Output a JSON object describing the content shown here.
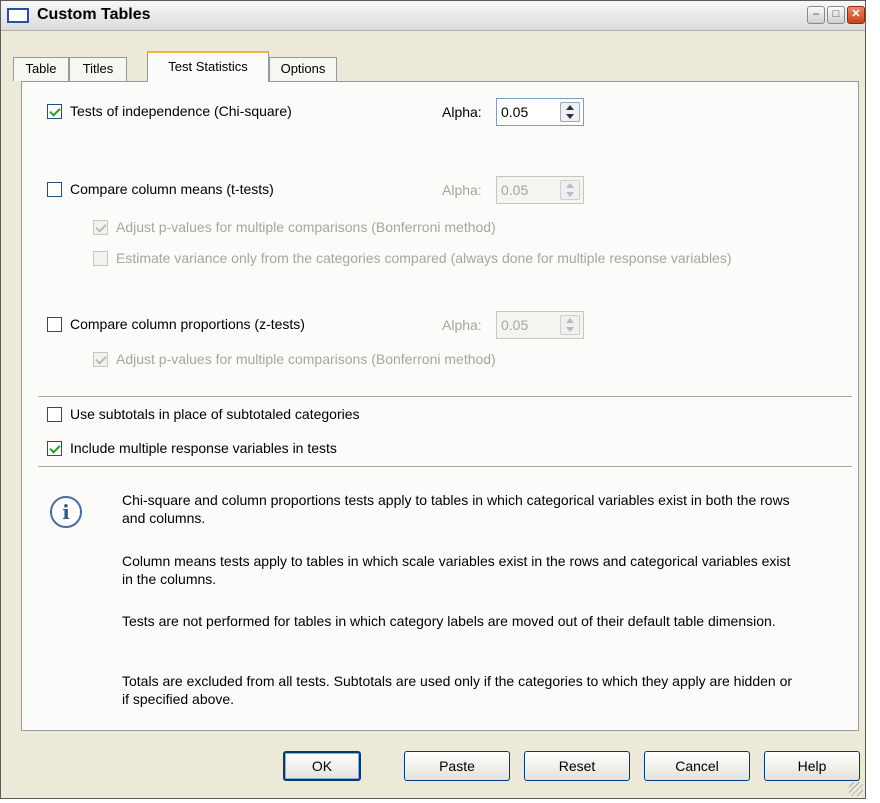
{
  "window": {
    "title": "Custom Tables"
  },
  "window_controls": {
    "minimize": "–",
    "maximize": "□",
    "close": "✕"
  },
  "tabs": [
    {
      "label": "Table",
      "active": false
    },
    {
      "label": "Titles",
      "active": false
    },
    {
      "label": "Test Statistics",
      "active": true
    },
    {
      "label": "Options",
      "active": false
    }
  ],
  "chi_square": {
    "label": "Tests of independence (Chi-square)",
    "checked": true,
    "alpha_label": "Alpha:",
    "alpha_value": "0.05"
  },
  "means": {
    "label": "Compare column means (t-tests)",
    "checked": false,
    "alpha_label": "Alpha:",
    "alpha_value": "0.05",
    "adjust_label": "Adjust p-values for multiple comparisons (Bonferroni method)",
    "adjust_checked": true,
    "estimate_label": "Estimate variance only from the categories compared (always done for multiple response variables)",
    "estimate_checked": false
  },
  "proportions": {
    "label": "Compare column proportions (z-tests)",
    "checked": false,
    "alpha_label": "Alpha:",
    "alpha_value": "0.05",
    "adjust_label": "Adjust p-values for multiple comparisons (Bonferroni method)",
    "adjust_checked": true
  },
  "subtotals": {
    "label": "Use subtotals in place of subtotaled categories",
    "checked": false
  },
  "multi_response": {
    "label": "Include multiple response variables in tests",
    "checked": true
  },
  "info": {
    "icon": "info-icon",
    "p1": "Chi-square and column proportions tests apply to tables in which categorical variables exist in both the rows and columns.",
    "p2": "Column means tests apply to tables in which scale variables exist in the rows and categorical variables exist in the columns.",
    "p3": "Tests are not performed for tables in which category labels are moved out of their default table dimension.",
    "p4": "Totals are excluded from all tests. Subtotals are used only if the categories to which they apply are hidden or if specified above."
  },
  "buttons": {
    "ok": "OK",
    "paste": "Paste",
    "reset": "Reset",
    "cancel": "Cancel",
    "help": "Help"
  }
}
